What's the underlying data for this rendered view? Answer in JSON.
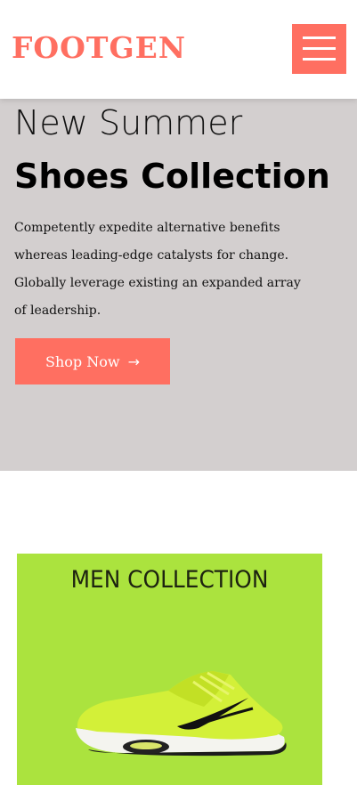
{
  "header": {
    "logo": "FOOTGEN",
    "menu_icon": "hamburger-menu-icon"
  },
  "hero": {
    "subtitle": "New Summer",
    "title": "Shoes Collection",
    "description_lines": [
      "Competently expedite alternative benefits",
      "whereas leading-edge catalysts for change.",
      "Globally leverage existing an expanded array",
      "of leadership."
    ],
    "cta_label": "Shop Now",
    "cta_icon": "arrow-right-icon"
  },
  "collection": {
    "title": "MEN COLLECTION",
    "image_icon": "sneaker-icon"
  },
  "colors": {
    "accent": "#ff6f61",
    "hero_bg": "#d3cfcf",
    "card_bg": "#abe33e"
  }
}
